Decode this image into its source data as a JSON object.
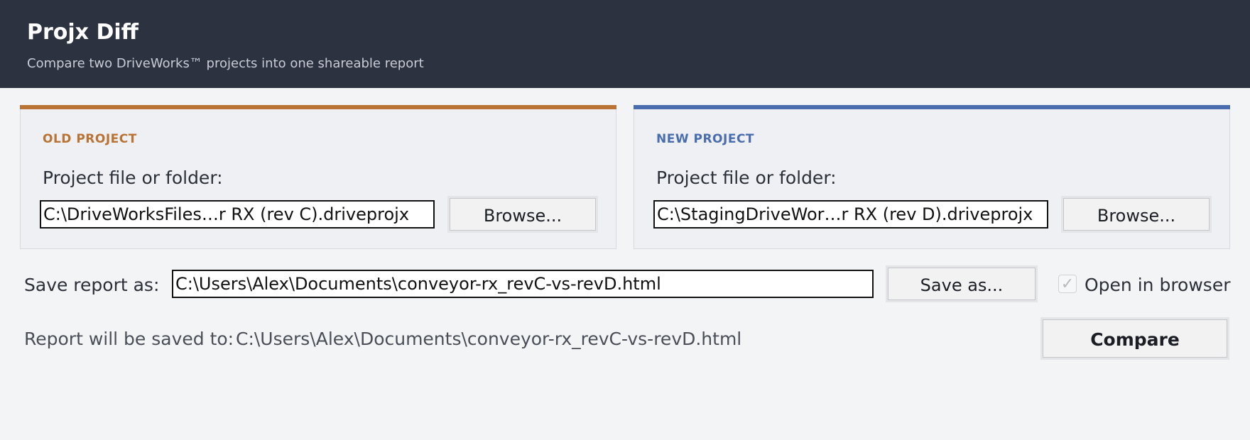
{
  "header": {
    "title": "Projx Diff",
    "subtitle": "Compare two DriveWorks™ projects into one shareable report"
  },
  "old_project": {
    "heading": "OLD PROJECT",
    "field_label": "Project file or folder:",
    "path_value": "C:\\DriveWorksFiles…r RX (rev C).driveprojx",
    "browse_label": "Browse...",
    "accent_color": "#b97334"
  },
  "new_project": {
    "heading": "NEW PROJECT",
    "field_label": "Project file or folder:",
    "path_value": "C:\\StagingDriveWor…r RX (rev D).driveprojx",
    "browse_label": "Browse...",
    "accent_color": "#4a6db0"
  },
  "save": {
    "label": "Save report as:",
    "path_value": "C:\\Users\\Alex\\Documents\\conveyor-rx_revC-vs-revD.html",
    "button_label": "Save as...",
    "open_in_browser_label": "Open in browser",
    "open_in_browser_checked": true
  },
  "report": {
    "label": "Report will be saved to:",
    "path": "C:\\Users\\Alex\\Documents\\conveyor-rx_revC-vs-revD.html",
    "compare_label": "Compare"
  }
}
